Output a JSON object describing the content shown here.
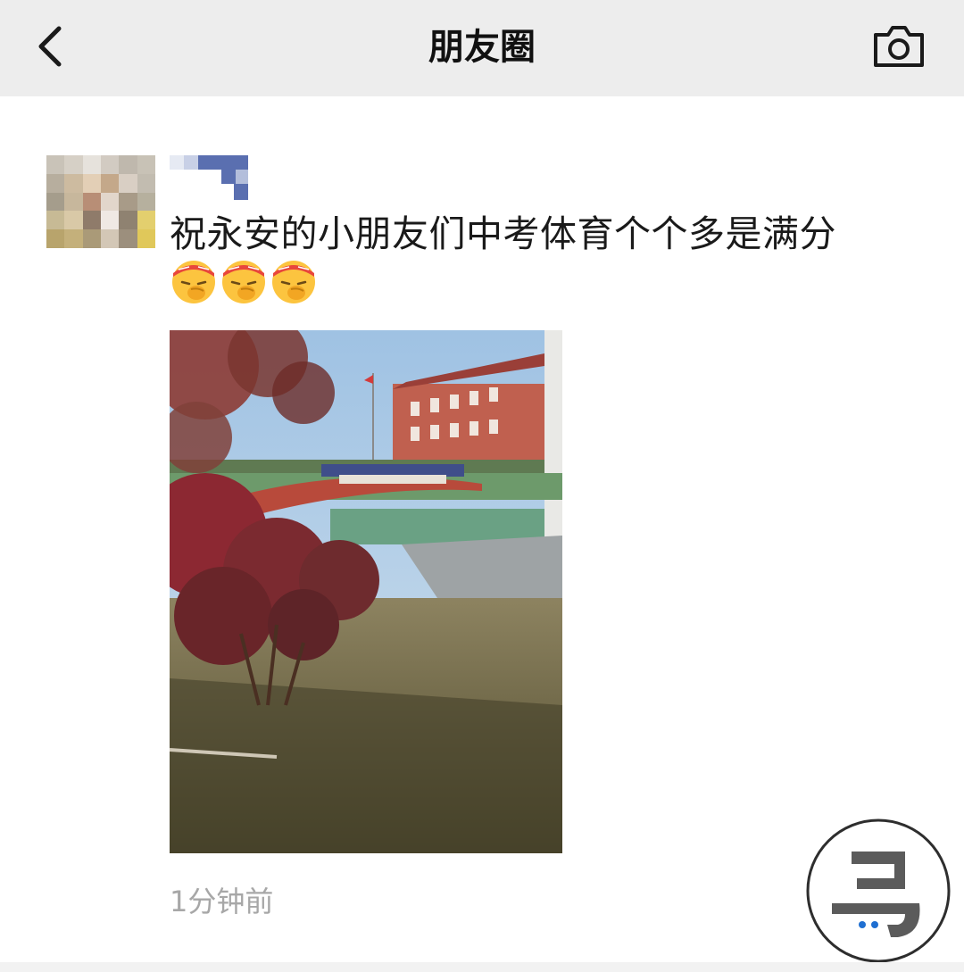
{
  "nav": {
    "title": "朋友圈",
    "back_icon": "chevron-left-icon",
    "camera_icon": "camera-icon"
  },
  "post": {
    "text": "祝永安的小朋友们中考体育个个多是满分",
    "emojis": [
      "shushing-face-headband-icon",
      "shushing-face-headband-icon",
      "shushing-face-headband-icon"
    ],
    "timestamp": "1分钟前"
  },
  "colors": {
    "nav_background": "#ededed",
    "title_text": "#111111",
    "timestamp_text": "#a7a7a7",
    "nickname_blue": "#5a6fb0"
  }
}
